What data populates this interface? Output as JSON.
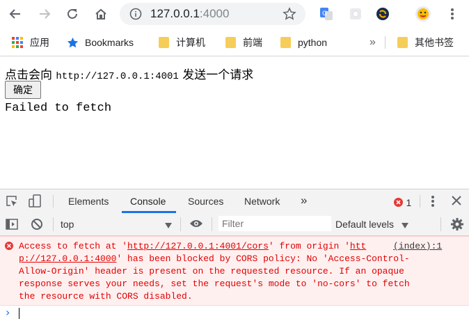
{
  "browser": {
    "url_host": "127.0.0.1",
    "url_port": ":4000",
    "icons": [
      "back-arrow-icon",
      "forward-arrow-icon",
      "reload-icon",
      "home-icon",
      "info-icon",
      "star-icon",
      "translate-icon",
      "extension-icon",
      "sync-icon",
      "avatar",
      "menu-icon"
    ]
  },
  "bookmarks": {
    "items": [
      {
        "label": "应用",
        "icon": "apps-grid-icon"
      },
      {
        "label": "Bookmarks",
        "icon": "star-icon"
      },
      {
        "label": "计算机",
        "icon": "folder-icon"
      },
      {
        "label": "前端",
        "icon": "folder-icon"
      },
      {
        "label": "python",
        "icon": "folder-icon"
      }
    ],
    "overflow": "»",
    "other": "其他书签"
  },
  "page": {
    "intro_prefix": "点击会向 ",
    "intro_url": "http://127.0.0.1:4001",
    "intro_suffix": " 发送一个请求",
    "button_label": "确定",
    "result": "Failed to fetch"
  },
  "devtools": {
    "tabs": [
      "Elements",
      "Console",
      "Sources",
      "Network"
    ],
    "active_tab": "Console",
    "more": "»",
    "error_count": "1",
    "context": "top",
    "filter_placeholder": "Filter",
    "levels": "Default levels",
    "error": {
      "p1": "Access to fetch at '",
      "link1": "http://127.0.0.1:4001/cors",
      "p2": "' from origin '",
      "link2a": "htt",
      "link2b": "p://127.0.0.1:4000",
      "p3": "' has been blocked by CORS policy: No 'Access-Control-",
      "line3": "Allow-Origin' header is present on the requested resource. If an opaque",
      "line4": "response serves your needs, set the request's mode to 'no-cors' to fetch",
      "line5": "the resource with CORS disabled.",
      "source": "(index):1"
    },
    "prompt": "›"
  },
  "colors": {
    "accent": "#1a73e8",
    "error_text": "#e20000",
    "error_bg": "#fff0f0",
    "folder": "#f7cd5a"
  }
}
